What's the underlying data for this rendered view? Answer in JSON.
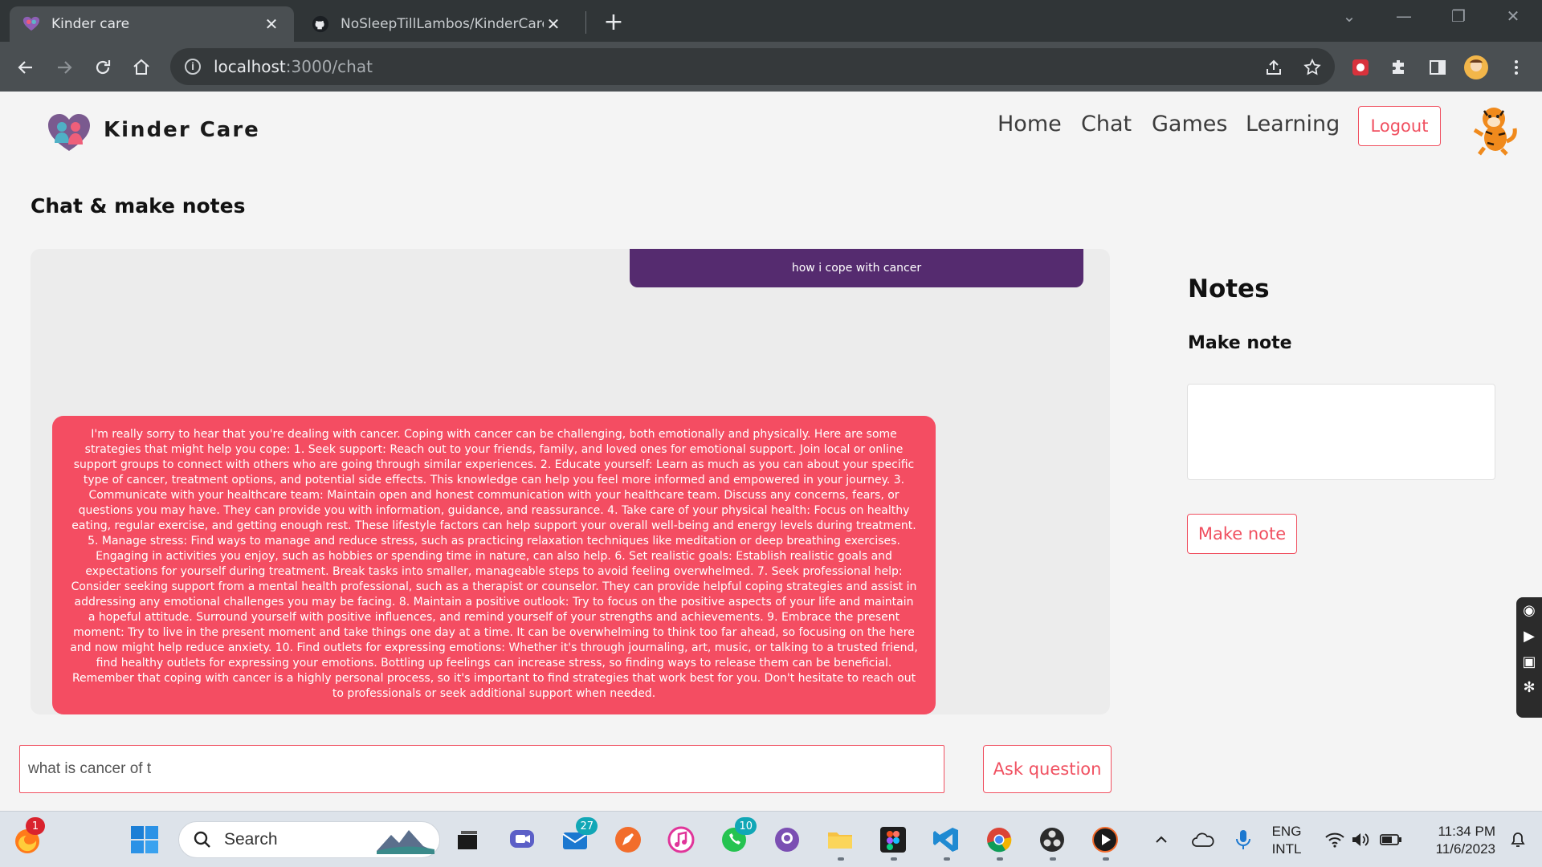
{
  "browser": {
    "tabs": [
      {
        "title": "Kinder care",
        "active": true
      },
      {
        "title": "NoSleepTillLambos/KinderCare:",
        "active": false
      }
    ],
    "url_host": "localhost",
    "url_path": ":3000/chat"
  },
  "header": {
    "brand": "Kinder Care",
    "nav": [
      "Home",
      "Chat",
      "Games",
      "Learning"
    ],
    "logout_label": "Logout"
  },
  "main": {
    "title": "Chat & make notes",
    "messages": [
      {
        "role": "user",
        "text": "how i cope with cancer"
      },
      {
        "role": "assistant",
        "text": "I'm really sorry to hear that you're dealing with cancer. Coping with cancer can be challenging, both emotionally and physically. Here are some strategies that might help you cope: 1. Seek support: Reach out to your friends, family, and loved ones for emotional support. Join local or online support groups to connect with others who are going through similar experiences. 2. Educate yourself: Learn as much as you can about your specific type of cancer, treatment options, and potential side effects. This knowledge can help you feel more informed and empowered in your journey. 3. Communicate with your healthcare team: Maintain open and honest communication with your healthcare team. Discuss any concerns, fears, or questions you may have. They can provide you with information, guidance, and reassurance. 4. Take care of your physical health: Focus on healthy eating, regular exercise, and getting enough rest. These lifestyle factors can help support your overall well-being and energy levels during treatment. 5. Manage stress: Find ways to manage and reduce stress, such as practicing relaxation techniques like meditation or deep breathing exercises. Engaging in activities you enjoy, such as hobbies or spending time in nature, can also help. 6. Set realistic goals: Establish realistic goals and expectations for yourself during treatment. Break tasks into smaller, manageable steps to avoid feeling overwhelmed. 7. Seek professional help: Consider seeking support from a mental health professional, such as a therapist or counselor. They can provide helpful coping strategies and assist in addressing any emotional challenges you may be facing. 8. Maintain a positive outlook: Try to focus on the positive aspects of your life and maintain a hopeful attitude. Surround yourself with positive influences, and remind yourself of your strengths and achievements. 9. Embrace the present moment: Try to live in the present moment and take things one day at a time. It can be overwhelming to think too far ahead, so focusing on the here and now might help reduce anxiety. 10. Find outlets for expressing emotions: Whether it's through journaling, art, music, or talking to a trusted friend, find healthy outlets for expressing your emotions. Bottling up feelings can increase stress, so finding ways to release them can be beneficial. Remember that coping with cancer is a highly personal process, so it's important to find strategies that work best for you. Don't hesitate to reach out to professionals or seek additional support when needed."
      }
    ],
    "question_value": "what is cancer of t",
    "ask_label": "Ask question"
  },
  "notes": {
    "title": "Notes",
    "make_note_label": "Make note",
    "note_value": "",
    "button_label": "Make note"
  },
  "taskbar": {
    "search_label": "Search",
    "badges": {
      "firefox": "1",
      "mail": "27",
      "whatsapp": "10"
    },
    "lang_top": "ENG",
    "lang_bottom": "INTL",
    "time": "11:34 PM",
    "date": "11/6/2023"
  },
  "colors": {
    "accent": "#f05060",
    "bot_bubble": "#f44d62",
    "user_bubble": "#552b6f"
  }
}
